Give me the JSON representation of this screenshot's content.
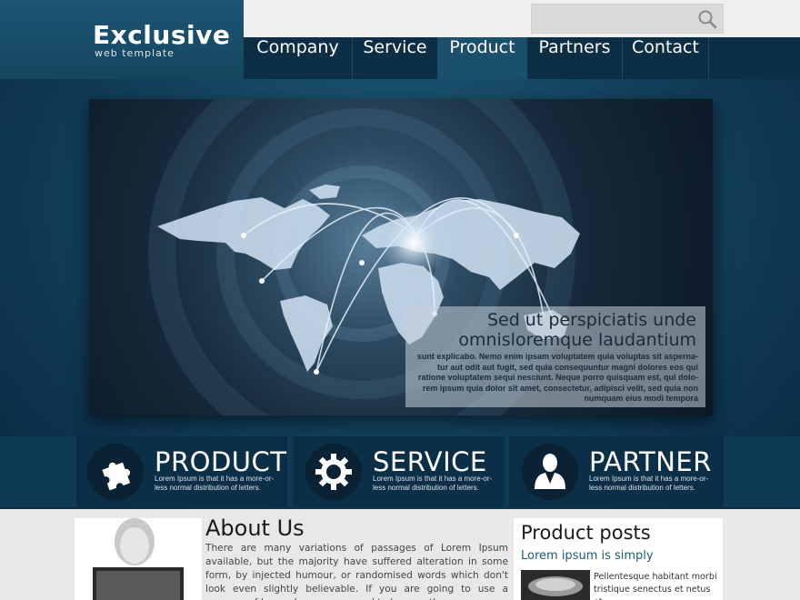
{
  "logo": {
    "title": "Exclusive",
    "subtitle": "web template"
  },
  "search": {
    "placeholder": "",
    "icon": "search-icon"
  },
  "nav": {
    "items": [
      {
        "label": "Company",
        "active": false
      },
      {
        "label": "Service",
        "active": false
      },
      {
        "label": "Product",
        "active": true
      },
      {
        "label": "Partners",
        "active": false
      },
      {
        "label": "Contact",
        "active": false
      }
    ]
  },
  "slider": {
    "caption_title": "Sed ut perspiciatis unde omnisloremque laudantium",
    "caption_body": "sunt explicabo. Nemo enim ipsam voluptatem quia voluptas sit asperna-tur aut odit aut fugit, sed quia consequuntur magni dolores eos qui ratione voluptatem sequi nesciunt. Neque porro quisquam est, qui dolo-rem ipsum quia dolor sit amet, consectetur, adipisci velit, sed quia non numquam eius modi tempora",
    "prev_icon": "chevron-left-icon",
    "next_icon": "chevron-right-icon"
  },
  "features": [
    {
      "title": "PRODUCT",
      "text": "Lorem Ipsum is that it has a more-or-less normal distribution of letters.",
      "icon": "puzzle-icon"
    },
    {
      "title": "SERVICE",
      "text": "Lorem Ipsum is that it has a more-or-less normal distribution of letters.",
      "icon": "gear-icon"
    },
    {
      "title": "PARTNER",
      "text": "Lorem Ipsum is that it has a more-or-less normal distribution of letters.",
      "icon": "person-icon"
    }
  ],
  "about": {
    "title": "About Us",
    "text": "There are many variations of passages of Lorem Ipsum available, but the majority have suffered alteration in some form, by injected humour, or randomised words which don't look even slightly believable. If you are going to use a passage of Lorem Ipsum, you need to be sure there"
  },
  "posts": {
    "title": "Product posts",
    "subtitle": "Lorem ipsum is simply",
    "text": "Pellentesque habitant morbi tristique senectus et netus et"
  },
  "colors": {
    "brand": "#164a66",
    "nav_bg": "#0d2f45",
    "nav_active": "#1a506c"
  }
}
